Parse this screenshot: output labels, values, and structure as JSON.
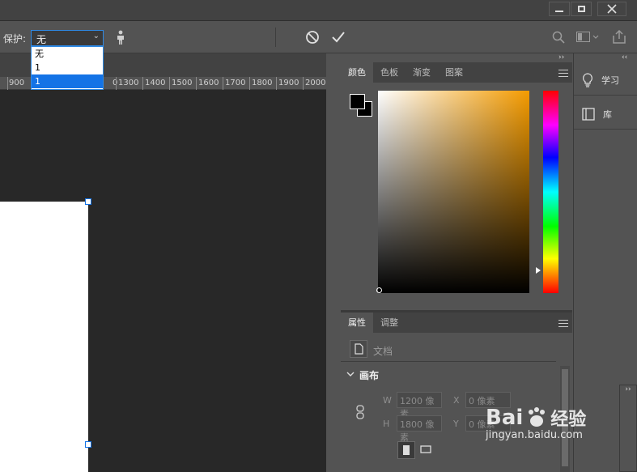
{
  "options_bar": {
    "protect_label": "保护:",
    "protect_value": "无",
    "dropdown_options": [
      "无",
      "1",
      "1"
    ]
  },
  "ruler": {
    "ticks": [
      "900",
      "1300",
      "1400",
      "1500",
      "1600",
      "1700",
      "1800",
      "1900",
      "2000"
    ],
    "partial_tick": "0"
  },
  "color_panel": {
    "tabs": [
      "颜色",
      "色板",
      "渐变",
      "图案"
    ],
    "active_tab": "颜色",
    "foreground_color": "#000000",
    "background_color": "#000000",
    "field_hue_color": "#f49b00"
  },
  "properties_panel": {
    "tabs": [
      "属性",
      "调整"
    ],
    "active_tab": "属性",
    "document_label": "文档",
    "section_title": "画布",
    "width_label": "W",
    "width_value": "1200 像素",
    "height_label": "H",
    "height_value": "1800 像素",
    "x_label": "X",
    "x_value": "0 像素",
    "y_label": "Y",
    "y_value": "0 像素"
  },
  "side_panel": {
    "items": [
      {
        "label": "学习",
        "icon": "lightbulb-icon"
      },
      {
        "label": "库",
        "icon": "library-icon"
      }
    ]
  },
  "watermark": {
    "brand": "Bai",
    "brand_suffix": "经验",
    "url": "jingyan.baidu.com"
  },
  "colors": {
    "accent": "#1473e6",
    "panel_bg": "#535353",
    "canvas_bg": "#282828"
  }
}
